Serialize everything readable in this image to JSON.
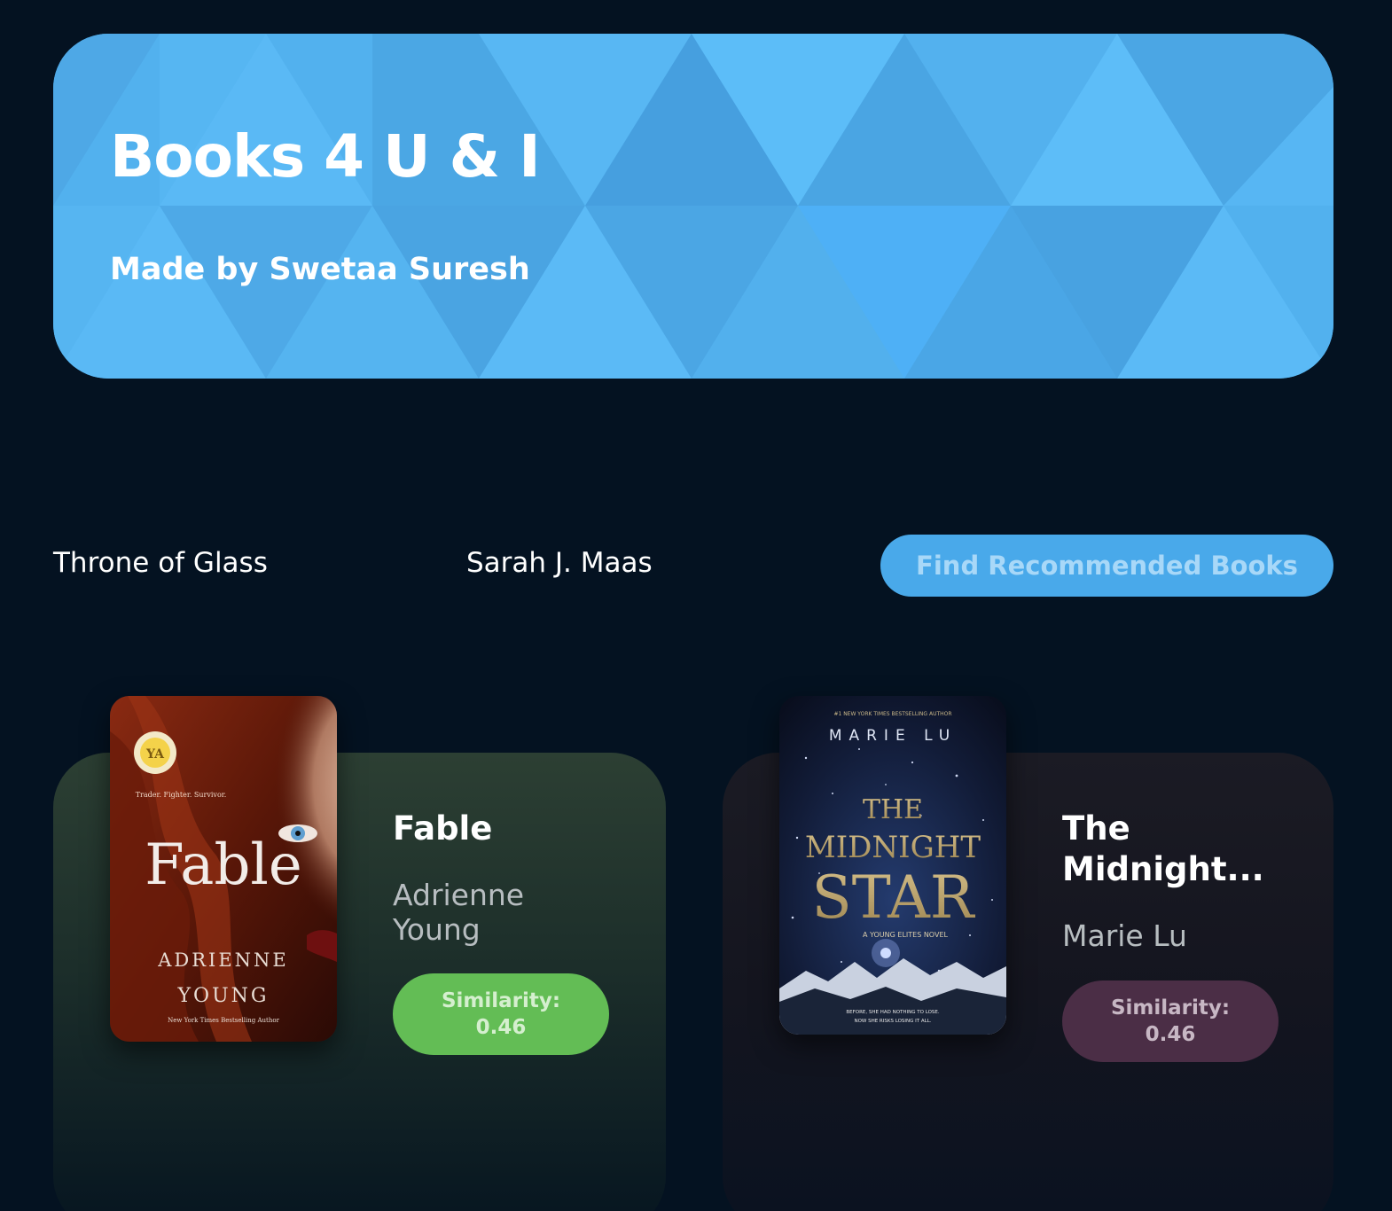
{
  "header": {
    "title": "Books 4 U & I",
    "subtitle": "Made by Swetaa Suresh"
  },
  "search": {
    "book_title": "Throne of Glass",
    "author": "Sarah J. Maas",
    "button_label": "Find Recommended Books"
  },
  "results": [
    {
      "title": "Fable",
      "author": "Adrienne Young",
      "similarity_label": "Similarity:",
      "similarity_value": "0.46",
      "cover": {
        "badge": "YA",
        "tagline": "Trader. Fighter. Survivor.",
        "cover_title": "Fable",
        "author_line1": "ADRIENNE",
        "author_line2": "YOUNG",
        "footer": "New York Times Bestselling Author"
      }
    },
    {
      "title": "The Midnight...",
      "author": "Marie Lu",
      "similarity_label": "Similarity:",
      "similarity_value": "0.46",
      "cover": {
        "top_line": "#1 NEW YORK TIMES BESTSELLING AUTHOR",
        "cover_author": "MARIE LU",
        "title_line1": "THE",
        "title_line2": "MIDNIGHT",
        "title_line3": "STAR",
        "series": "A YOUNG ELITES NOVEL",
        "footer1": "BEFORE, SHE HAD NOTHING TO LOSE.",
        "footer2": "NOW SHE RISKS LOSING IT ALL."
      }
    }
  ],
  "colors": {
    "background": "#041221",
    "banner": "#52b1ee",
    "button": "#49a9ea",
    "similarity_green": "#63bd55",
    "similarity_purple": "#4b2e46"
  }
}
